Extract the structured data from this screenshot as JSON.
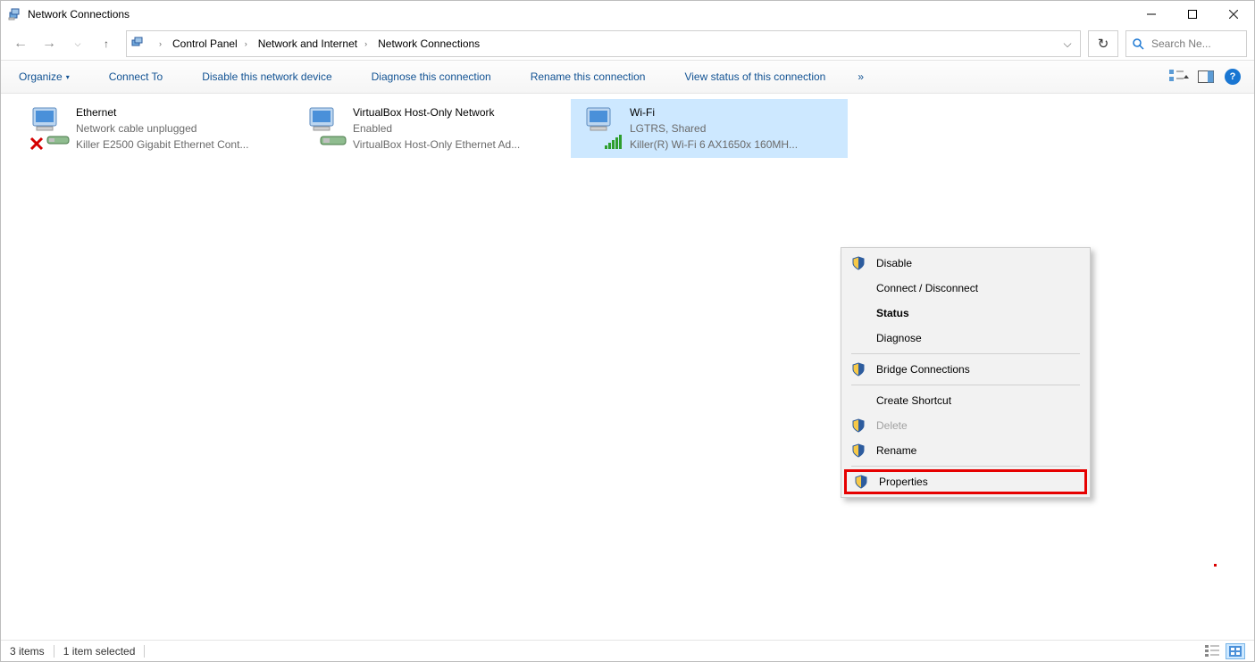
{
  "window": {
    "title": "Network Connections"
  },
  "breadcrumbs": {
    "items": [
      "Control Panel",
      "Network and Internet",
      "Network Connections"
    ]
  },
  "search": {
    "placeholder": "Search Ne..."
  },
  "commandbar": {
    "organize": "Organize",
    "connect_to": "Connect To",
    "disable": "Disable this network device",
    "diagnose": "Diagnose this connection",
    "rename": "Rename this connection",
    "view_status": "View status of this connection"
  },
  "connections": [
    {
      "name": "Ethernet",
      "status": "Network cable unplugged",
      "device": "Killer E2500 Gigabit Ethernet Cont...",
      "state": "unplugged",
      "selected": false
    },
    {
      "name": "VirtualBox Host-Only Network",
      "status": "Enabled",
      "device": "VirtualBox Host-Only Ethernet Ad...",
      "state": "enabled",
      "selected": false
    },
    {
      "name": "Wi-Fi",
      "status": "LGTRS, Shared",
      "device": "Killer(R) Wi-Fi 6 AX1650x 160MH...",
      "state": "wifi",
      "selected": true
    }
  ],
  "context_menu": {
    "disable": "Disable",
    "connect_disconnect": "Connect / Disconnect",
    "status": "Status",
    "diagnose": "Diagnose",
    "bridge": "Bridge Connections",
    "create_shortcut": "Create Shortcut",
    "delete": "Delete",
    "rename": "Rename",
    "properties": "Properties"
  },
  "statusbar": {
    "item_count": "3 items",
    "selection": "1 item selected"
  }
}
